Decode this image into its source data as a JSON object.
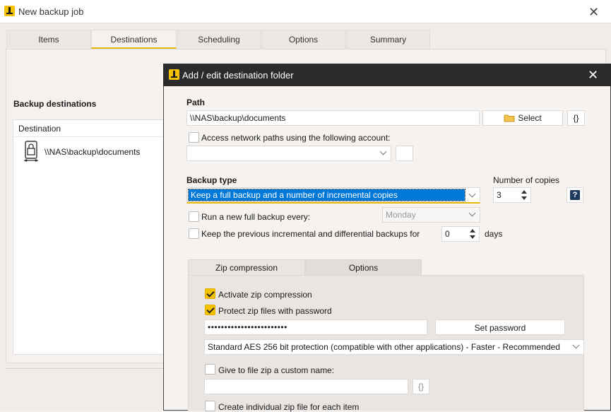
{
  "window": {
    "title": "New backup job"
  },
  "tabs": [
    {
      "label": "Items"
    },
    {
      "label": "Destinations"
    },
    {
      "label": "Scheduling"
    },
    {
      "label": "Options"
    },
    {
      "label": "Summary"
    }
  ],
  "backup_destinations": {
    "title": "Backup destinations",
    "column_header": "Destination",
    "items": [
      {
        "path": "\\\\NAS\\backup\\documents"
      }
    ]
  },
  "dialog": {
    "title": "Add / edit destination folder",
    "path_label": "Path",
    "path_value": "\\\\NAS\\backup\\documents",
    "select_label": "Select",
    "variables_label": "{}",
    "network_account_label": "Access network paths using the following account:",
    "backup_type_label": "Backup type",
    "backup_type_value": "Keep a full backup and a number of incremental copies",
    "copies_label": "Number of copies",
    "copies_value": "3",
    "help_label": "?",
    "full_backup_label": "Run a new full backup every:",
    "full_backup_day": "Monday",
    "keep_previous_label": "Keep the previous incremental and differential backups for",
    "keep_days_value": "0",
    "days_label": "days",
    "subtabs": [
      {
        "label": "Zip compression"
      },
      {
        "label": "Options"
      }
    ],
    "zip": {
      "activate_label": "Activate zip compression",
      "activate_checked": true,
      "protect_label": "Protect zip files with password",
      "protect_checked": true,
      "password_mask": "••••••••••••••••••••••••",
      "set_password_label": "Set password",
      "encryption_value": "Standard AES 256 bit protection (compatible with other applications) - Faster - Recommended",
      "custom_name_label": "Give to file zip a custom name:",
      "custom_name_variables": "{}",
      "individual_label": "Create individual zip file for each item"
    }
  },
  "colors": {
    "accent": "#f5c200",
    "dialog_titlebar": "#2b2b2b",
    "selection": "#0078d7"
  },
  "icons": [
    "app-logo-icon",
    "close-icon",
    "nas-lock-icon",
    "folder-icon",
    "help-icon",
    "chevron-down-icon",
    "spinner-arrows-icon"
  ]
}
